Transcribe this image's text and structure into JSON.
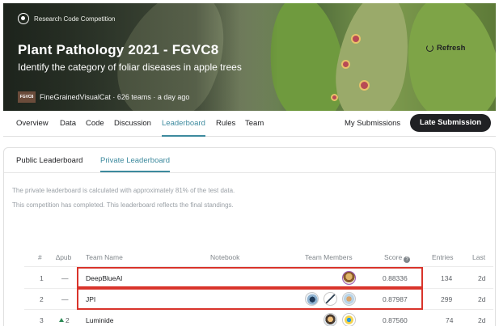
{
  "banner": {
    "badge": "Research Code Competition",
    "title": "Plant Pathology 2021 - FGVC8",
    "subtitle": "Identify the category of foliar diseases in apple trees",
    "host_logo": "FGVC8",
    "host_info": "FineGrainedVisualCat · 626 teams · a day ago"
  },
  "nav": {
    "tabs": [
      "Overview",
      "Data",
      "Code",
      "Discussion",
      "Leaderboard",
      "Rules",
      "Team"
    ],
    "active": "Leaderboard",
    "my_submissions": "My Submissions",
    "late_submission": "Late Submission"
  },
  "leaderboard": {
    "tabs": [
      "Public Leaderboard",
      "Private Leaderboard"
    ],
    "active_tab": "Private Leaderboard",
    "info_line_1": "The private leaderboard is calculated with approximately 81% of the test data.",
    "info_line_2": "This competition has completed. This leaderboard reflects the final standings.",
    "refresh": "Refresh",
    "headers": {
      "rank": "#",
      "delta": "∆pub",
      "team": "Team Name",
      "notebook": "Notebook",
      "members": "Team Members",
      "score": "Score",
      "entries": "Entries",
      "last": "Last"
    },
    "rows": [
      {
        "rank": "1",
        "delta": "—",
        "team": "DeepBlueAI",
        "score": "0.88336",
        "entries": "134",
        "last": "2d"
      },
      {
        "rank": "2",
        "delta": "—",
        "team": "JPI",
        "score": "0.87987",
        "entries": "299",
        "last": "2d"
      },
      {
        "rank": "3",
        "delta": "2",
        "team": "Luminide",
        "score": "0.87560",
        "entries": "74",
        "last": "2d"
      }
    ]
  },
  "colors": {
    "accent": "#3d8a9e",
    "highlight": "#d9342b",
    "dark": "#202124"
  }
}
